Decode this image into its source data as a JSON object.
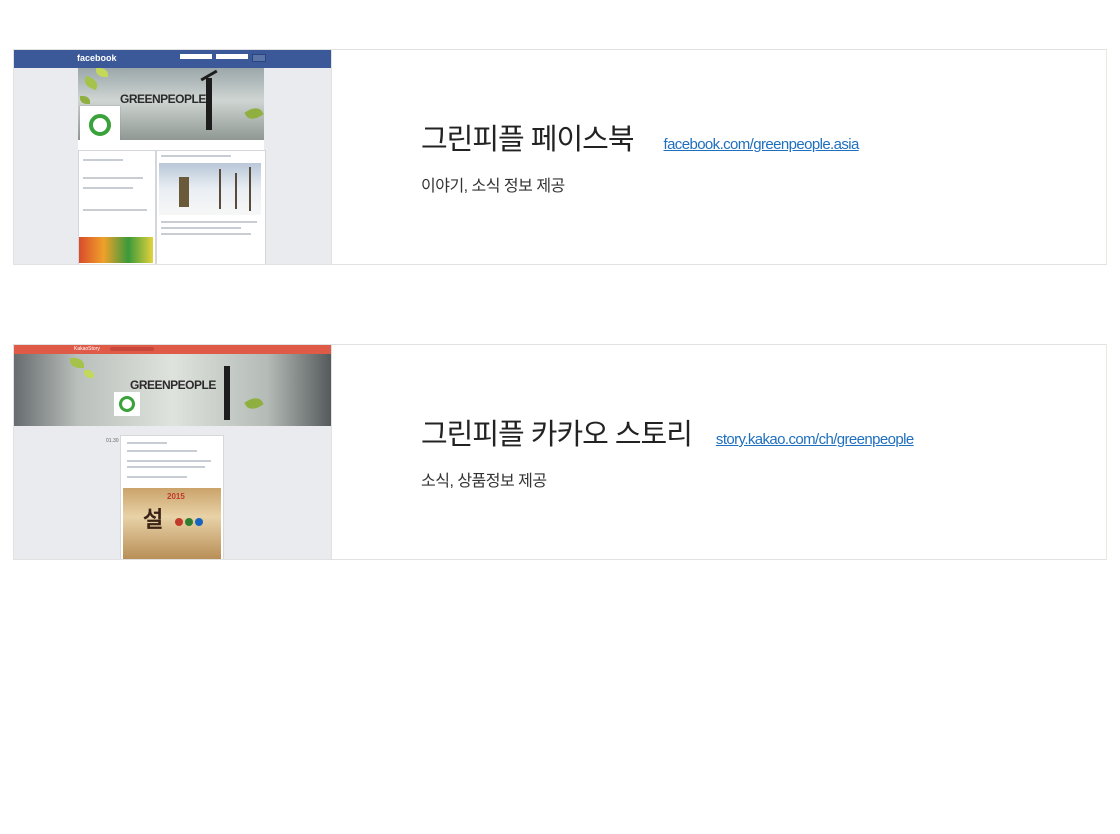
{
  "cards": [
    {
      "title": "그린피플 페이스북",
      "link": "facebook.com/greenpeople.asia",
      "description": "이야기, 소식 정보 제공",
      "thumbnail": {
        "brand_text": "facebook",
        "logo_text": "GREENPEOPLE"
      }
    },
    {
      "title": "그린피플 카카오 스토리",
      "link": "story.kakao.com/ch/greenpeople",
      "description": "소식, 상품정보 제공",
      "thumbnail": {
        "brand_text": "KakaoStory",
        "logo_text": "GREENPEOPLE",
        "post_date": "01.30",
        "banner_year": "2015",
        "banner_char": "설"
      }
    }
  ],
  "colors": {
    "facebook_blue": "#3b5998",
    "kakao_red": "#e05a48",
    "link_blue": "#1f6fbf",
    "leaf_green": "#a5c24a"
  }
}
